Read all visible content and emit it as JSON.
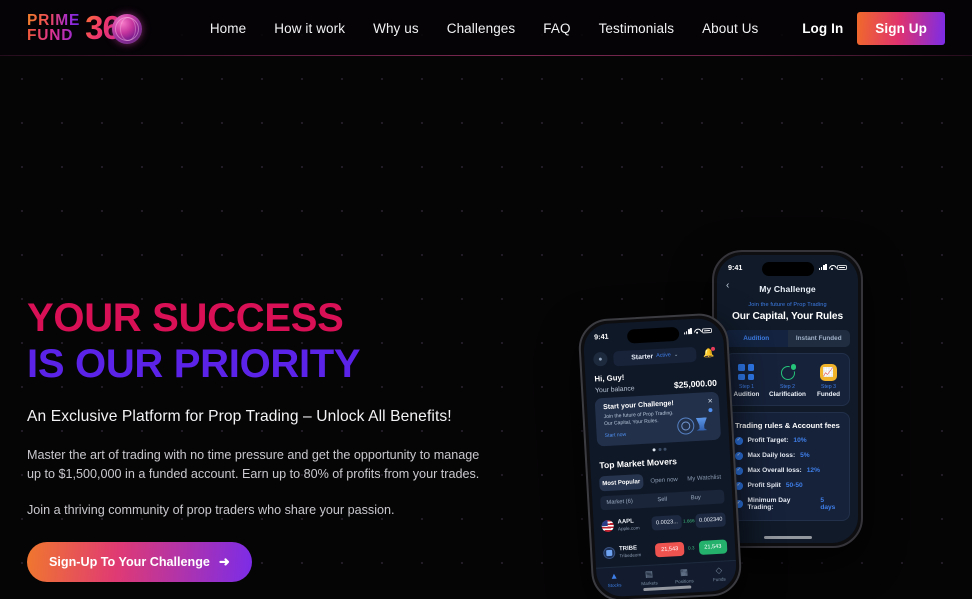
{
  "brand": {
    "line1": "PRIME",
    "line2": "FUND",
    "num": "36",
    "globe_icon": "globe-icon",
    "accent_orange": "#f0772e",
    "accent_pink": "#e0326f",
    "accent_purple": "#7b2ce8"
  },
  "nav": {
    "items": [
      {
        "label": "Home"
      },
      {
        "label": "How it work"
      },
      {
        "label": "Why us"
      },
      {
        "label": "Challenges"
      },
      {
        "label": "FAQ"
      },
      {
        "label": "Testimonials"
      },
      {
        "label": "About Us"
      }
    ],
    "login_label": "Log In",
    "signup_label": "Sign Up"
  },
  "hero": {
    "headline_line1": "YOUR SUCCESS",
    "headline_line2": "IS OUR PRIORITY",
    "headline_color1": "#d91055",
    "headline_color2": "#5b23e8",
    "subtitle": "An Exclusive Platform for Prop Trading – Unlock All Benefits!",
    "paragraph1": "Master the art of trading with no time pressure and get the opportunity to manage up to $1,500,000 in a funded account. Earn up to 80% of profits from your trades.",
    "paragraph2": "Join a thriving community of prop traders who share your passion.",
    "cta_label": "Sign-Up To Your Challenge",
    "cta_arrow": "➜"
  },
  "phone_left": {
    "status_time": "9:41",
    "account_select": "Starter",
    "account_state": "Active",
    "chevron": "⌄",
    "greeting": "Hi, Guy!",
    "balance_label": "Your balance",
    "balance_value": "$25,000.00",
    "promo": {
      "title": "Start your Challenge!",
      "body": "Join the future of Prop Trading. Our Capital, Your Rules.",
      "link": "Start now",
      "close": "✕"
    },
    "section_title": "Top Market Movers",
    "tabs": [
      {
        "label": "Most Popular",
        "active": true
      },
      {
        "label": "Open now",
        "active": false
      },
      {
        "label": "My Watchlist",
        "active": false
      }
    ],
    "table_headers": {
      "market": "Market (6)",
      "sell": "Sell",
      "buy": "Buy"
    },
    "rows": [
      {
        "symbol": "AAPL",
        "company": "Apple.com",
        "icon": "us-flag-icon",
        "sell": "0.0023...",
        "spread": "1.666",
        "buy": "0.002340",
        "highlight": false
      },
      {
        "symbol": "TRIBE",
        "company": "Tribedeom",
        "icon": "tribe-icon",
        "sell": "21,543",
        "spread": "0.3",
        "buy": "21,543",
        "highlight": true
      }
    ],
    "bottom_nav": [
      {
        "label": "Stocks",
        "icon": "home-icon",
        "active": true
      },
      {
        "label": "Markets",
        "icon": "bars-icon",
        "active": false
      },
      {
        "label": "Positions",
        "icon": "positions-icon",
        "active": false
      },
      {
        "label": "Funds",
        "icon": "funds-icon",
        "active": false
      }
    ]
  },
  "phone_right": {
    "status_time": "9:41",
    "back_icon": "chevron-left-icon",
    "title": "My Challenge",
    "eyebrow": "Join the future of Prop Trading",
    "headline": "Our Capital, Your Rules",
    "tabs": [
      {
        "label": "Audition",
        "active": true
      },
      {
        "label": "Instant Funded",
        "active": false
      }
    ],
    "steps": [
      {
        "step": "Step 1",
        "label": "Audition",
        "icon": "grid-icon"
      },
      {
        "step": "Step 2",
        "label": "Clarification",
        "icon": "refresh-icon"
      },
      {
        "step": "Step 3",
        "label": "Funded",
        "icon": "chart-icon"
      }
    ],
    "rules_title": "Trading rules & Account fees",
    "rules": [
      {
        "label": "Profit Target:",
        "value": "10%"
      },
      {
        "label": "Max Daily loss:",
        "value": "5%"
      },
      {
        "label": "Max Overall loss:",
        "value": "12%"
      },
      {
        "label": "Profit Split",
        "value": "50-50"
      },
      {
        "label": "Minimum Day Trading:",
        "value": "5 days"
      }
    ]
  }
}
